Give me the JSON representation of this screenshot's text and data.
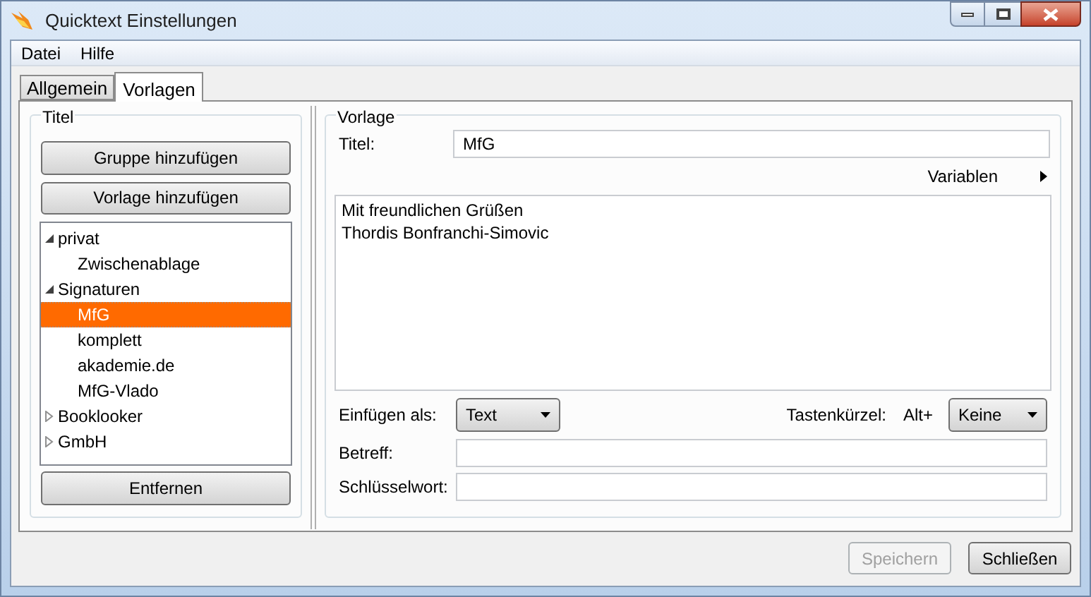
{
  "window": {
    "title": "Quicktext Einstellungen"
  },
  "menu": [
    "Datei",
    "Hilfe"
  ],
  "tabs": [
    {
      "label": "Allgemein",
      "selected": false
    },
    {
      "label": "Vorlagen",
      "selected": true
    }
  ],
  "left_panel": {
    "legend": "Titel",
    "buttons": [
      "Gruppe hinzufügen",
      "Vorlage hinzufügen"
    ],
    "tree": [
      {
        "label": "privat",
        "expanded": true,
        "selected": false,
        "children": [
          {
            "label": "Zwischenablage",
            "selected": false
          }
        ]
      },
      {
        "label": "Signaturen",
        "expanded": true,
        "selected": false,
        "children": [
          {
            "label": "MfG",
            "selected": true
          },
          {
            "label": "komplett",
            "selected": false
          },
          {
            "label": "akademie.de",
            "selected": false
          },
          {
            "label": "MfG-Vlado",
            "selected": false
          }
        ]
      },
      {
        "label": "Booklooker",
        "expanded": false,
        "selected": false
      },
      {
        "label": "GmbH",
        "expanded": false,
        "selected": false
      }
    ],
    "remove_button": "Entfernen"
  },
  "right_panel": {
    "legend": "Vorlage",
    "title_label": "Titel:",
    "title_value": "MfG",
    "variables_menu": "Variablen",
    "text_lines": [
      "Mit freundlichen Grüßen",
      "Thordis Bonfranchi-Simovic"
    ],
    "insert_label": "Einfügen als:",
    "insert_value": "Text",
    "shortcut_label": "Tastenkürzel:",
    "shortcut_prefix": "Alt+",
    "shortcut_value": "Keine",
    "subject_label": "Betreff:",
    "keyword_label": "Schlüsselwort:"
  },
  "footer_buttons": [
    {
      "label": "Speichern",
      "disabled": true
    },
    {
      "label": "Schließen",
      "disabled": false
    }
  ]
}
